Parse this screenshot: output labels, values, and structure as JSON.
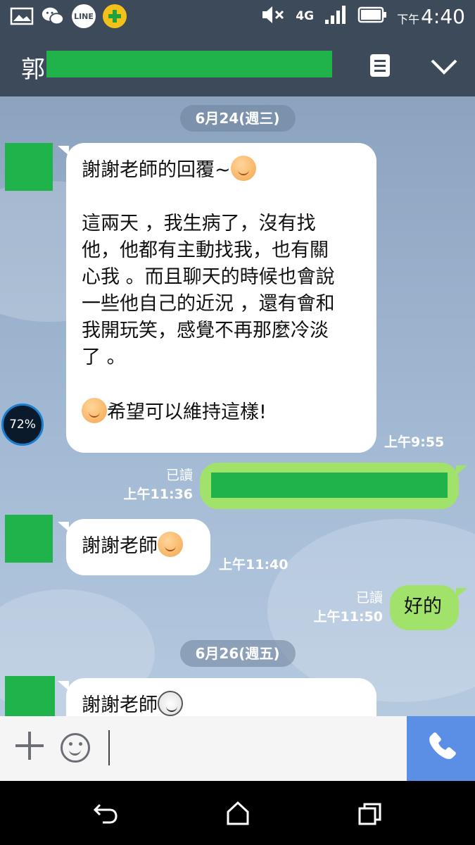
{
  "status_bar": {
    "time_prefix": "下午",
    "time": "4:40",
    "network": "4G",
    "left_icons": [
      "gallery-icon",
      "wechat-icon",
      "line-icon",
      "plus-app-icon"
    ],
    "right_icons": [
      "mute-icon",
      "signal-icon",
      "battery-icon"
    ]
  },
  "header": {
    "title": "郭",
    "icons": [
      "notes-icon",
      "chevron-down-icon"
    ]
  },
  "chat": {
    "date_1": "6月24(週三)",
    "date_2": "6月26(週五)",
    "battery_widget": "72%",
    "messages": [
      {
        "side": "left",
        "line_1": "謝謝老師的回覆~",
        "body": "這兩天 ，我生病了，沒有找\n他，他都有主動找我，也有關\n心我 。而且聊天的時候也會說\n一些他自己的近況 ，還有會和\n我開玩笑，感覺不再那麼冷淡\n了 。",
        "last_line": "希望可以維持這樣!",
        "time": "上午9:55"
      },
      {
        "side": "right",
        "read": "已讀",
        "time": "上午11:36",
        "text": ""
      },
      {
        "side": "left",
        "text": "謝謝老師",
        "time": "上午11:40"
      },
      {
        "side": "right",
        "read": "已讀",
        "time": "上午11:50",
        "text": "好的"
      },
      {
        "side": "left",
        "text": "謝謝老師"
      }
    ]
  },
  "input_bar": {
    "icons": [
      "plus-icon",
      "emoji-icon",
      "phone-icon"
    ]
  },
  "nav_bar": {
    "icons": [
      "back-icon",
      "home-icon",
      "recents-icon"
    ]
  },
  "colors": {
    "header_bg": "#3d4a5a",
    "redaction": "#21b34b",
    "my_bubble": "#a0e26a",
    "call_button": "#5b8ee5"
  }
}
